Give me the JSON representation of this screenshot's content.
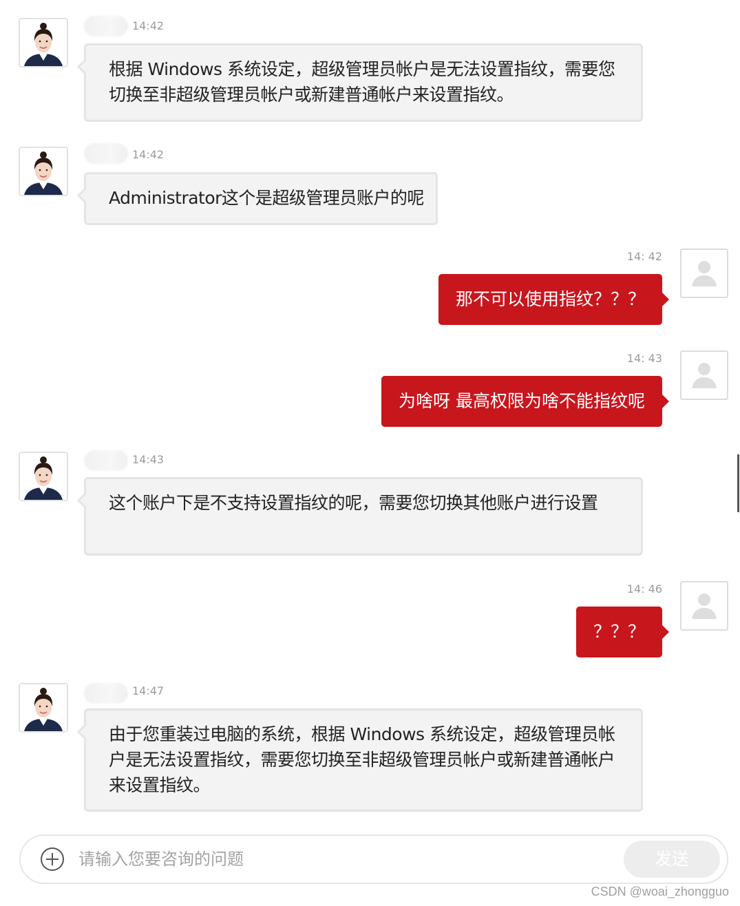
{
  "chat": {
    "messages": [
      {
        "sender": "agent",
        "time": "14:42",
        "text": "根据 Windows 系统设定，超级管理员帐户是无法设置指纹，需要您切换至非超级管理员帐户或新建普通帐户来设置指纹。"
      },
      {
        "sender": "agent",
        "time": "14:42",
        "text": "Administrator这个是超级管理员账户的呢"
      },
      {
        "sender": "user",
        "time": "14: 42",
        "text": "那不可以使用指纹？？？"
      },
      {
        "sender": "user",
        "time": "14: 43",
        "text": "为啥呀 最高权限为啥不能指纹呢"
      },
      {
        "sender": "agent",
        "time": "14:43",
        "text": "这个账户下是不支持设置指纹的呢，需要您切换其他账户进行设置"
      },
      {
        "sender": "user",
        "time": "14: 46",
        "text": "？？？"
      },
      {
        "sender": "agent",
        "time": "14:47",
        "text": "由于您重装过电脑的系统，根据 Windows 系统设定，超级管理员帐户是无法设置指纹，需要您切换至非超级管理员帐户或新建普通帐户来设置指纹。"
      }
    ]
  },
  "composer": {
    "placeholder": "请输入您要咨询的问题",
    "send_label": "发送",
    "attach_icon": "plus-circle-icon"
  },
  "watermark": "CSDN @woai_zhongguo",
  "colors": {
    "user_bubble": "#c8161d",
    "agent_bubble": "#f3f3f3",
    "agent_border": "#e4e4e4"
  }
}
